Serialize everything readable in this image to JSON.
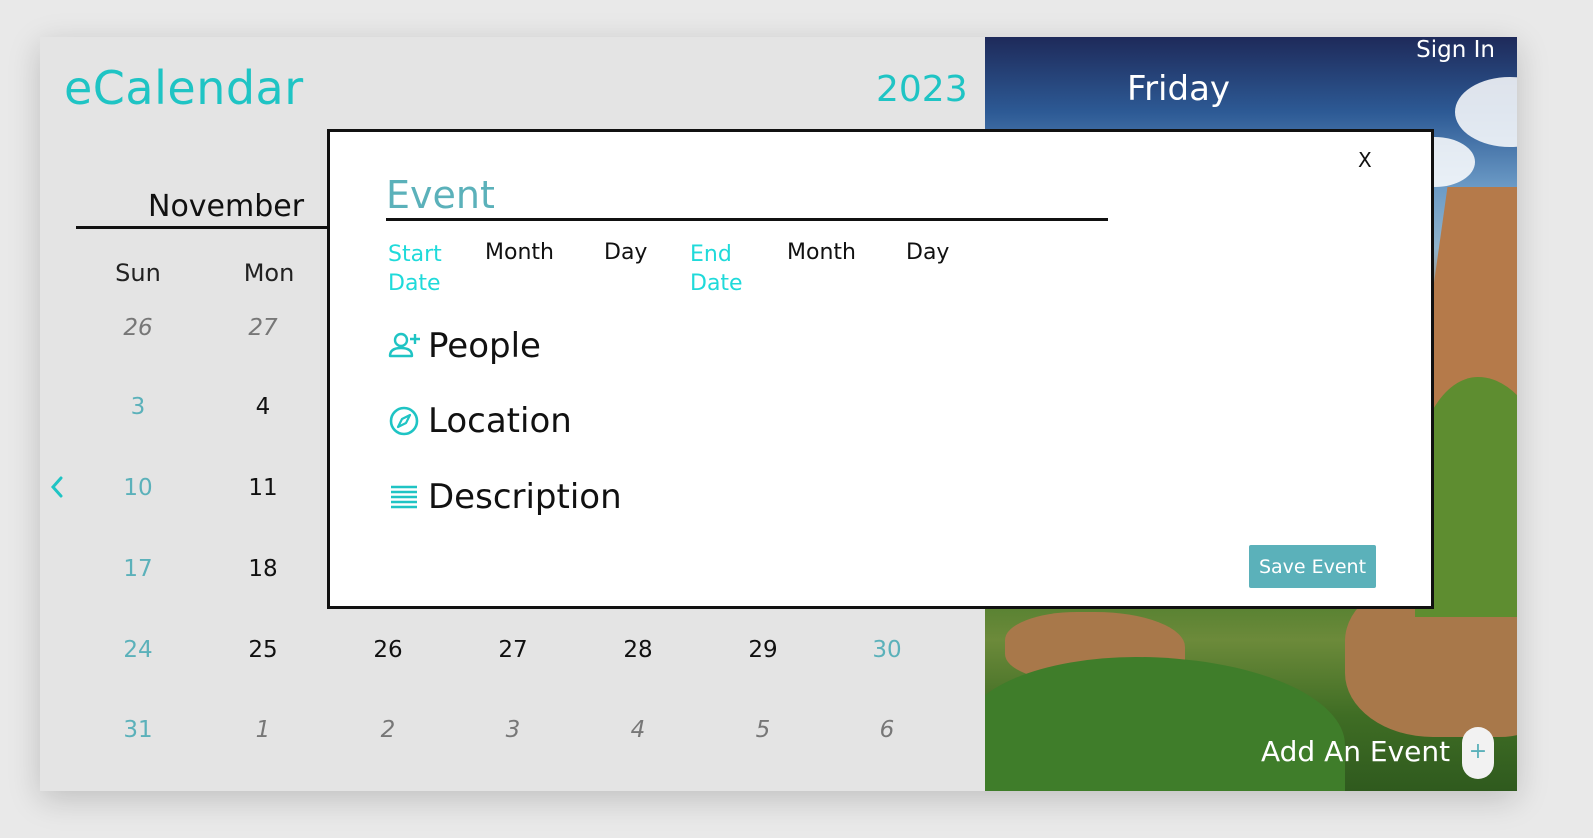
{
  "app": {
    "brand": "eCalendar",
    "year": "2023",
    "month": "November",
    "weekdays_visible": [
      "Sun",
      "Mon"
    ],
    "calendar_rows": [
      [
        {
          "d": "26",
          "k": "other"
        },
        {
          "d": "27",
          "k": "other"
        }
      ],
      [
        {
          "d": "3",
          "k": "weekend"
        },
        {
          "d": "4",
          "k": "normal"
        }
      ],
      [
        {
          "d": "10",
          "k": "weekend"
        },
        {
          "d": "11",
          "k": "normal"
        }
      ],
      [
        {
          "d": "17",
          "k": "weekend"
        },
        {
          "d": "18",
          "k": "normal"
        }
      ],
      [
        {
          "d": "24",
          "k": "weekend"
        },
        {
          "d": "25",
          "k": "normal"
        },
        {
          "d": "26",
          "k": "normal"
        },
        {
          "d": "27",
          "k": "normal"
        },
        {
          "d": "28",
          "k": "normal"
        },
        {
          "d": "29",
          "k": "normal"
        },
        {
          "d": "30",
          "k": "weekend"
        }
      ],
      [
        {
          "d": "31",
          "k": "weekend"
        },
        {
          "d": "1",
          "k": "other"
        },
        {
          "d": "2",
          "k": "other"
        },
        {
          "d": "3",
          "k": "other"
        },
        {
          "d": "4",
          "k": "other"
        },
        {
          "d": "5",
          "k": "other"
        },
        {
          "d": "6",
          "k": "other"
        }
      ]
    ]
  },
  "side": {
    "sign_in": "Sign In",
    "day_name": "Friday",
    "add_event": "Add An Event",
    "add_symbol": "+"
  },
  "modal": {
    "close": "X",
    "event_placeholder": "Event",
    "start_label": "Start Date",
    "end_label": "End Date",
    "month_label": "Month",
    "day_label": "Day",
    "people": "People",
    "location": "Location",
    "description": "Description",
    "save": "Save Event"
  },
  "colors": {
    "accent": "#1fc4c4",
    "teal_button": "#5bb1ba",
    "date_label": "#1fdada"
  }
}
